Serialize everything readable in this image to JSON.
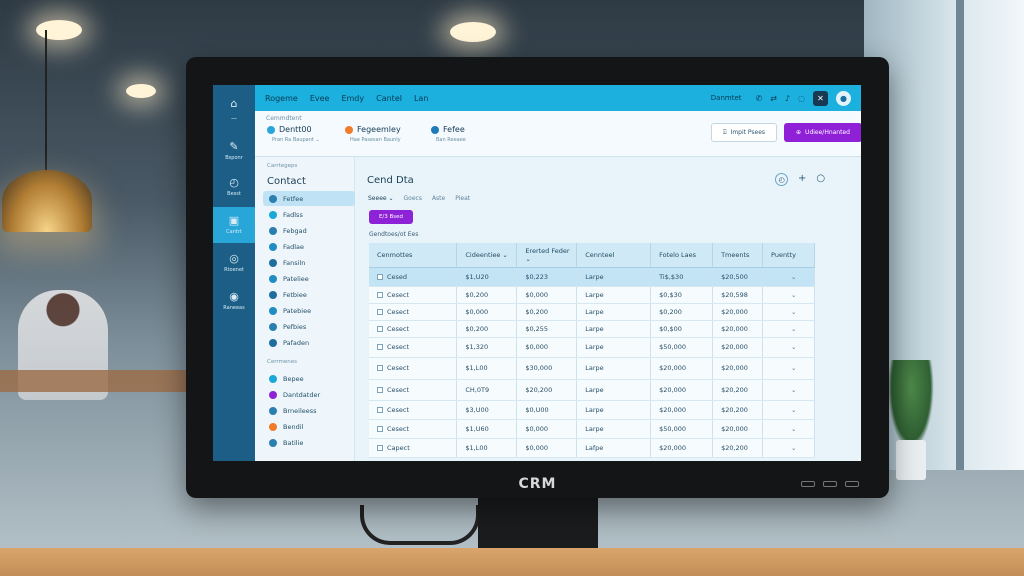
{
  "monitor": {
    "brand": "CRM"
  },
  "topbar": {
    "nav": [
      "Rogeme",
      "Evee",
      "Emdy",
      "Cantel",
      "Lan"
    ],
    "user": "Danmtet"
  },
  "strip": {
    "title": "Cemmdtent",
    "accounts": [
      {
        "name": "Dentt00",
        "sub": "Pran Ra Baupant  ⌄",
        "color": "#29a6d8"
      },
      {
        "name": "Fegeemley",
        "sub": "Hae Pasesan Baunly",
        "color": "#f07b2b"
      },
      {
        "name": "Fefee",
        "sub": "Ban Reeaee",
        "color": "#1f7bb8"
      }
    ],
    "btn_outline": "Impit Psees",
    "btn_primary": "Udiee/Hnanted"
  },
  "rail": [
    {
      "icon": "⌂",
      "label": ""
    },
    {
      "icon": "—",
      "label": ""
    },
    {
      "icon": "✎",
      "label": "Bsponr"
    },
    {
      "icon": "◴",
      "label": "Besst"
    },
    {
      "icon": "▣",
      "label": "Cantrt"
    },
    {
      "icon": "◎",
      "label": "Rtoenet"
    },
    {
      "icon": "◉",
      "label": "Raneeas"
    }
  ],
  "sidebar": {
    "section1": "Carrtegeps",
    "heading": "Contact",
    "items": [
      {
        "label": "Fetfee",
        "color": "#2a7fb0"
      },
      {
        "label": "Fadlss",
        "color": "#1aa8d8"
      },
      {
        "label": "Febgad",
        "color": "#2a7fb0"
      },
      {
        "label": "Fadlae",
        "color": "#1f8cc2"
      },
      {
        "label": "Fansiln",
        "color": "#1f6c9e"
      },
      {
        "label": "Pateliee",
        "color": "#1f8cc2"
      },
      {
        "label": "Fetbiee",
        "color": "#1f6c9e"
      },
      {
        "label": "Patebiee",
        "color": "#1f8cc2"
      },
      {
        "label": "Pefbies",
        "color": "#2a7fb0"
      },
      {
        "label": "Pafaden",
        "color": "#1f6c9e"
      }
    ],
    "section2": "Cerrmenes",
    "items2": [
      {
        "label": "Bepee",
        "color": "#1aa8d8"
      },
      {
        "label": "Dantdatder",
        "color": "#8d22d6"
      },
      {
        "label": "Brneileess",
        "color": "#2a7fb0"
      },
      {
        "label": "Bendil",
        "color": "#f07b2b"
      },
      {
        "label": "Batilie",
        "color": "#2a7fb0"
      }
    ]
  },
  "main": {
    "title": "Cend Dta",
    "tools": [
      "◴",
      "+",
      "○"
    ],
    "subtabs": [
      "Seeee  ⌄",
      "Goecs",
      "Aste",
      "Pieat"
    ],
    "purple_btn": "E/3 Bsed",
    "section": "Gendtoes/ot Ees",
    "columns": [
      "Cenmottes",
      "Cideentiee  ⌄",
      "Ererted Feder  ⌄",
      "Cennteel",
      "Fotelo Laes",
      "Tmeents",
      "Puentty"
    ],
    "rows": [
      [
        "Cesed",
        "$1,U20",
        "$0,223",
        "Larpe",
        "Ti$,$30",
        "$20,500",
        "⌄"
      ],
      [
        "Cesect",
        "$0,200",
        "$0,000",
        "Larpe",
        "$0,$30",
        "$20,598",
        "⌄"
      ],
      [
        "Cesect",
        "$0,000",
        "$0,200",
        "Larpe",
        "$0,200",
        "$20,000",
        "⌄"
      ],
      [
        "Cesect",
        "$0,200",
        "$0,255",
        "Larpe",
        "$0,$00",
        "$20,000",
        "⌄"
      ],
      [
        "Cesect",
        "$1,320",
        "$0,000",
        "Larpe",
        "$50,000",
        "$20,000",
        "⌄"
      ],
      [
        "Cesect",
        "$1,L00",
        "$30,000",
        "Larpe",
        "$20,000",
        "$20,000",
        "⌄"
      ],
      [
        "Cesect",
        "CH,0T9",
        "$20,200",
        "Larpe",
        "$20,000",
        "$20,200",
        "⌄"
      ],
      [
        "Cesect",
        "$3,U00",
        "$0,U00",
        "Larpe",
        "$20,000",
        "$20,200",
        "⌄"
      ],
      [
        "Cesect",
        "$1,U60",
        "$0,000",
        "Larpe",
        "$50,000",
        "$20,000",
        "⌄"
      ],
      [
        "Capect",
        "$1,L00",
        "$0,000",
        "Lafpe",
        "$20,000",
        "$20,200",
        "⌄"
      ]
    ]
  }
}
